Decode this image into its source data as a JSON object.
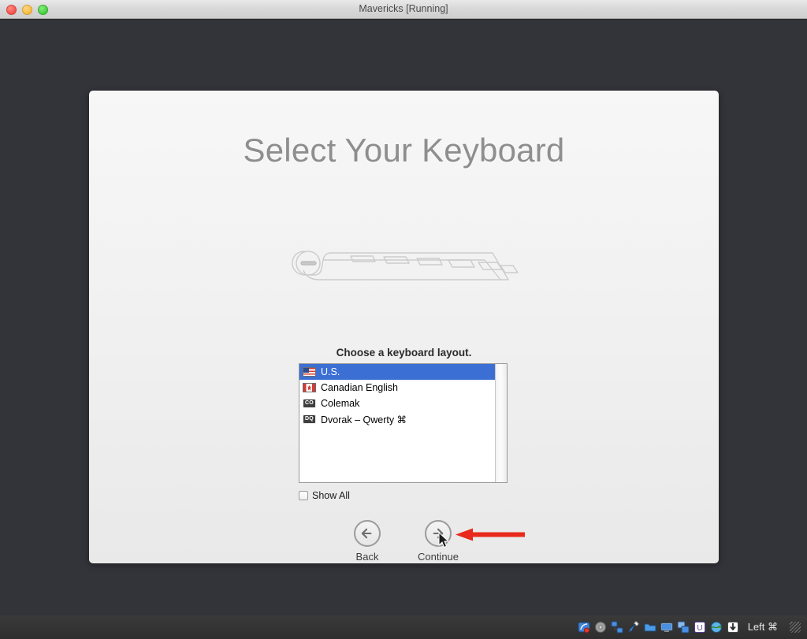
{
  "window": {
    "title": "Mavericks [Running]",
    "controls": [
      {
        "name": "close",
        "color": "#f05349"
      },
      {
        "name": "minimize",
        "color": "#f4bd3f"
      },
      {
        "name": "zoom",
        "color": "#44ce3c"
      }
    ]
  },
  "desktop": {
    "background_color": "#33333a"
  },
  "installer": {
    "headline": "Select Your Keyboard",
    "illustration": "keyboard-illustration",
    "prompt": "Choose a keyboard layout.",
    "list": {
      "selection_color": "#3b6fd4",
      "items": [
        {
          "icon": "us-flag-icon",
          "label": "U.S.",
          "selected": true
        },
        {
          "icon": "canada-flag-icon",
          "label": "Canadian English",
          "selected": false
        },
        {
          "icon": "colemak-badge-icon",
          "badge": "CO",
          "label": "Colemak",
          "selected": false
        },
        {
          "icon": "dvorak-badge-icon",
          "badge": "DQ",
          "label": "Dvorak – Qwerty ⌘",
          "selected": false
        }
      ]
    },
    "show_all": {
      "label": "Show All",
      "checked": false
    },
    "buttons": {
      "back": {
        "label": "Back",
        "icon": "arrow-left-circle-icon"
      },
      "continue": {
        "label": "Continue",
        "icon": "arrow-right-circle-icon"
      }
    }
  },
  "annotation": {
    "arrow": "red-arrow-pointing-left",
    "arrow_color": "#e8291c",
    "cursor": "mouse-pointer"
  },
  "statusbar": {
    "icons": [
      "hard-disk-icon",
      "optical-disk-icon",
      "network-icon",
      "usb-icon",
      "shared-folders-icon",
      "display-icon",
      "remote-display-icon",
      "guest-additions-icon",
      "globe-icon",
      "capture-icon"
    ],
    "host_key": "Left ⌘"
  }
}
